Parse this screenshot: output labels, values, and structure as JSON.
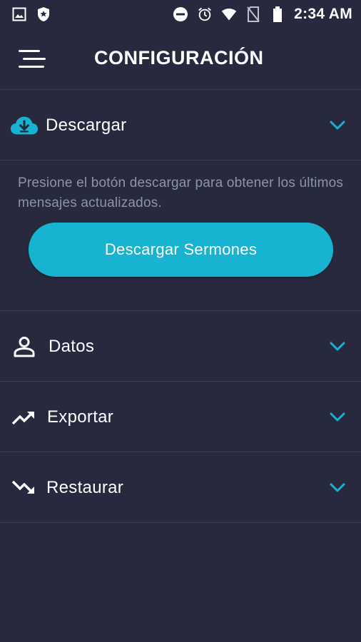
{
  "status_bar": {
    "time": "2:34 AM",
    "left_icons": [
      "image-icon",
      "shield-icon"
    ],
    "right_icons": [
      "dnd-icon",
      "alarm-icon",
      "wifi-icon",
      "no-sim-icon",
      "battery-icon"
    ]
  },
  "header": {
    "title": "CONFIGURACIÓN",
    "menu_icon": "menu-icon"
  },
  "sections": {
    "descargar": {
      "label": "Descargar",
      "icon": "cloud-download-icon",
      "expanded": true,
      "description": "Presione el botón descargar para obtener los últimos mensajes actualizados.",
      "button_label": "Descargar Sermones"
    },
    "datos": {
      "label": "Datos",
      "icon": "person-icon",
      "expanded": false
    },
    "exportar": {
      "label": "Exportar",
      "icon": "trending-up-icon",
      "expanded": false
    },
    "restaurar": {
      "label": "Restaurar",
      "icon": "trending-down-icon",
      "expanded": false
    }
  },
  "colors": {
    "background": "#272a3f",
    "accent": "#17b3d0",
    "divider": "#3a3e55",
    "description_text": "#8f93a8"
  }
}
